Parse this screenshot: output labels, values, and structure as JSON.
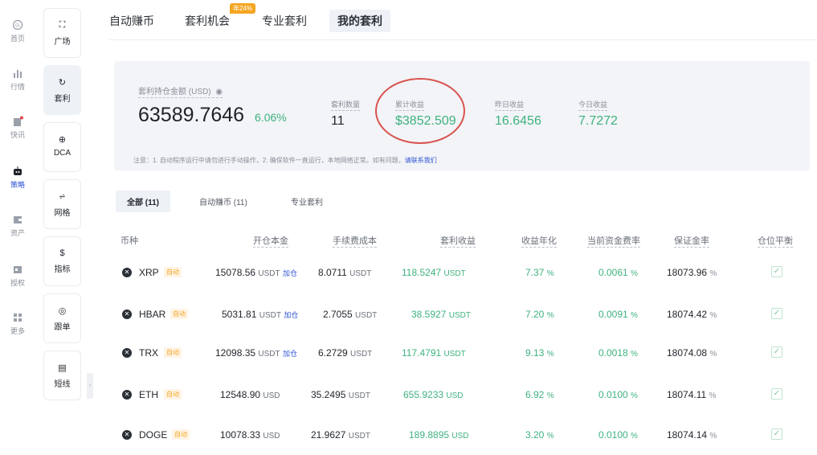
{
  "leftnav": [
    {
      "label": "首页",
      "icon": "home-icon"
    },
    {
      "label": "行情",
      "icon": "chart-bars-icon"
    },
    {
      "label": "快讯",
      "icon": "news-icon"
    },
    {
      "label": "策略",
      "icon": "robot-icon"
    },
    {
      "label": "资产",
      "icon": "wallet-icon"
    },
    {
      "label": "授权",
      "icon": "key-icon"
    },
    {
      "label": "更多",
      "icon": "grid-icon"
    }
  ],
  "subnav": [
    {
      "label": "广场",
      "icon": "robot-icon"
    },
    {
      "label": "套利",
      "icon": "refresh-icon"
    },
    {
      "label": "DCA",
      "icon": "coin-icon"
    },
    {
      "label": "网格",
      "icon": "grid-chart-icon"
    },
    {
      "label": "指标",
      "icon": "dollar-icon"
    },
    {
      "label": "跟单",
      "icon": "copy-icon"
    },
    {
      "label": "短线",
      "icon": "document-icon"
    }
  ],
  "tabs": [
    "自动赚币",
    "套利机会",
    "专业套利",
    "我的套利"
  ],
  "tab_badge": "年24%",
  "summary": {
    "holdings_label": "套利持仓金额 (USD)",
    "holdings_value": "63589.7646",
    "holdings_pct": "6.06%",
    "count_label": "套利数量",
    "count_value": "11",
    "cumulative_label": "累计收益",
    "cumulative_value": "$3852.509",
    "yesterday_label": "昨日收益",
    "yesterday_value": "16.6456",
    "today_label": "今日收益",
    "today_value": "7.7272",
    "notice": "注意：1. 自动程序运行中请勿进行手动操作，2. 确保软件一直运行，本地网络正常。如有问题，",
    "notice_link": "请联系我们"
  },
  "filter_tabs": [
    "全部 (11)",
    "自动赚币 (11)",
    "专业套利"
  ],
  "table": {
    "headers": [
      "币种",
      "开仓本金",
      "手续费成本",
      "套利收益",
      "收益年化",
      "当前资金费率",
      "保证金率",
      "仓位平衡"
    ],
    "auto_tag": "自动",
    "add_label": "加仓",
    "rows": [
      {
        "coin": "XRP",
        "principal": "15078.56",
        "principal_unit": "USDT",
        "add": true,
        "fee": "8.0711",
        "fee_unit": "USDT",
        "profit": "118.5247",
        "profit_unit": "USDT",
        "apy": "7.37",
        "rate": "0.0061",
        "margin": "18073.96"
      },
      {
        "coin": "HBAR",
        "principal": "5031.81",
        "principal_unit": "USDT",
        "add": true,
        "fee": "2.7055",
        "fee_unit": "USDT",
        "profit": "38.5927",
        "profit_unit": "USDT",
        "apy": "7.20",
        "rate": "0.0091",
        "margin": "18074.42"
      },
      {
        "coin": "TRX",
        "principal": "12098.35",
        "principal_unit": "USDT",
        "add": true,
        "fee": "6.2729",
        "fee_unit": "USDT",
        "profit": "117.4791",
        "profit_unit": "USDT",
        "apy": "9.13",
        "rate": "0.0018",
        "margin": "18074.08"
      },
      {
        "coin": "ETH",
        "principal": "12548.90",
        "principal_unit": "USD",
        "add": false,
        "fee": "35.2495",
        "fee_unit": "USDT",
        "profit": "655.9233",
        "profit_unit": "USD",
        "apy": "6.92",
        "rate": "0.0100",
        "margin": "18074.11"
      },
      {
        "coin": "DOGE",
        "principal": "10078.33",
        "principal_unit": "USD",
        "add": false,
        "fee": "21.9627",
        "fee_unit": "USDT",
        "profit": "189.8895",
        "profit_unit": "USD",
        "apy": "3.20",
        "rate": "0.0100",
        "margin": "18074.14"
      }
    ],
    "pct_sign": "%"
  },
  "colors": {
    "accent": "#2f55d4",
    "positive": "#3fb27f",
    "badge": "#f5a623",
    "highlight_circle": "#d9534f"
  }
}
